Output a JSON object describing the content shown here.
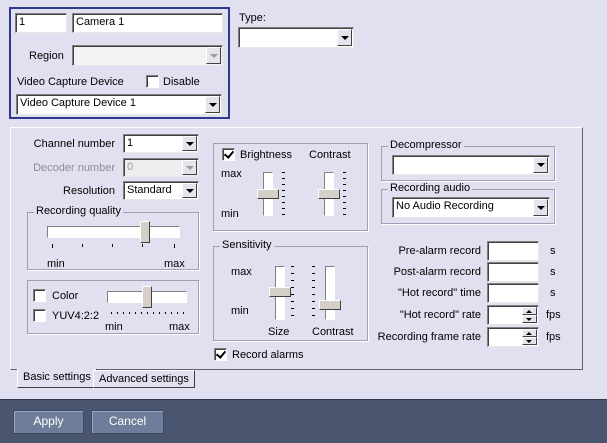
{
  "camera": {
    "number": "1",
    "name": "Camera 1"
  },
  "type": {
    "label": "Type:",
    "value": ""
  },
  "region": {
    "label": "Region",
    "value": ""
  },
  "video_capture": {
    "label": "Video Capture Device",
    "disable_label": "Disable",
    "disable_checked": false,
    "device": "Video Capture Device 1"
  },
  "channel": {
    "label": "Channel number",
    "value": "1"
  },
  "decoder": {
    "label": "Decoder number",
    "value": "0",
    "disabled": true
  },
  "resolution": {
    "label": "Resolution",
    "value": "Standard"
  },
  "recording_quality": {
    "label": "Recording quality",
    "min": "min",
    "max": "max",
    "level": 0.75
  },
  "color": {
    "color_label": "Color",
    "yuv_label": "YUV4:2:2",
    "color_checked": false,
    "yuv_checked": false,
    "min": "min",
    "max": "max",
    "level": 0.5
  },
  "brightness": {
    "label": "Brightness",
    "checked": true,
    "max": "max",
    "min": "min",
    "level": 0.5
  },
  "contrast": {
    "label": "Contrast",
    "level": 0.5
  },
  "sensitivity": {
    "label": "Sensitivity",
    "max": "max",
    "min": "min",
    "size_label": "Size",
    "contrast_label": "Contrast",
    "size_level": 0.5,
    "contrast_level": 0.25
  },
  "record_alarms": {
    "label": "Record alarms",
    "checked": true
  },
  "decompressor": {
    "label": "Decompressor",
    "value": ""
  },
  "recording_audio": {
    "label": "Recording audio",
    "value": "No Audio Recording"
  },
  "timing": {
    "pre_alarm": {
      "label": "Pre-alarm record",
      "value": "",
      "unit": "s"
    },
    "post_alarm": {
      "label": "Post-alarm record",
      "value": "",
      "unit": "s"
    },
    "hot_record_time": {
      "label": "\"Hot record\" time",
      "value": "",
      "unit": "s"
    },
    "hot_record_rate": {
      "label": "\"Hot record\" rate",
      "value": "",
      "unit": "fps"
    },
    "recording_frame_rate": {
      "label": "Recording frame rate",
      "value": "",
      "unit": "fps"
    }
  },
  "tabs": {
    "basic": "Basic settings",
    "advanced": "Advanced settings"
  },
  "buttons": {
    "apply": "Apply",
    "cancel": "Cancel"
  },
  "colors": {
    "background": "#E1E0F0",
    "selection_border": "#2B3A8C",
    "button_fill": "#6E7D99",
    "bottom_bar": "#4A566F"
  }
}
